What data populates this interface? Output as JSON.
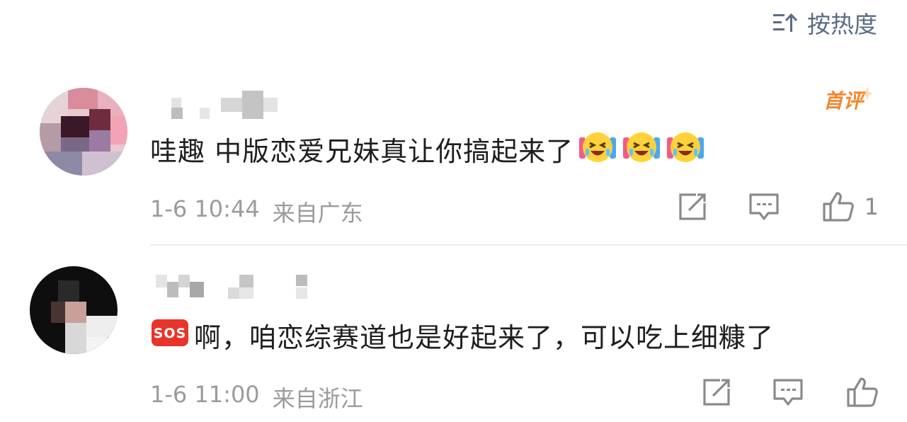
{
  "sort": {
    "label": "按热度",
    "icon": "sort-up-icon"
  },
  "comments": [
    {
      "text": "哇趣 中版恋爱兄妹真让你搞起来了",
      "emojis": [
        "laugh-cry-emoji",
        "laugh-cry-emoji",
        "laugh-cry-emoji"
      ],
      "date": "1-6 10:44",
      "location": "来自广东",
      "badge": "首评",
      "like_count": "1"
    },
    {
      "prefix_icon": "sos-emoji",
      "text": "啊，咱恋综赛道也是好起来了，可以吃上细糠了",
      "date": "1-6 11:00",
      "location": "来自浙江",
      "like_count": ""
    }
  ],
  "colors": {
    "sort": "#5a6b84",
    "badge": "#f5862a",
    "meta": "#9b9b9b"
  }
}
